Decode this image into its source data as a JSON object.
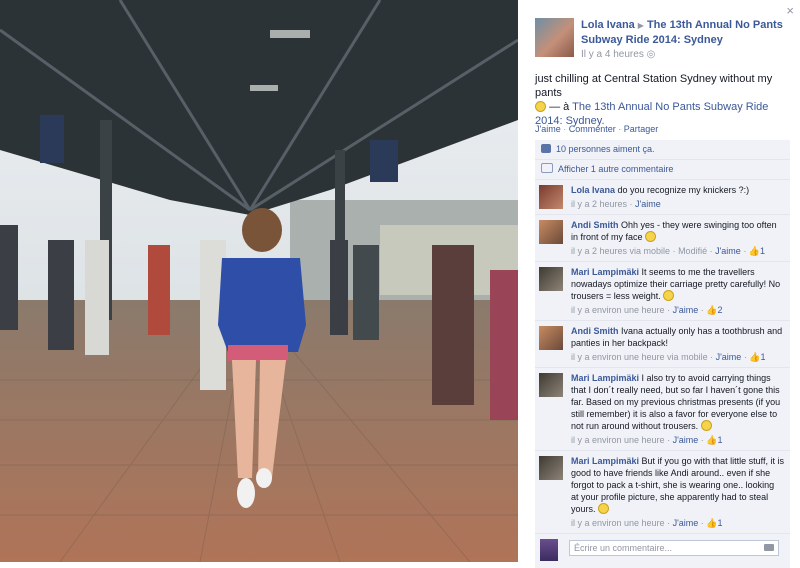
{
  "photo": {
    "alt": "Woman without pants walking on Sydney Central Station platform"
  },
  "header": {
    "author": "Lola Ivana",
    "event_link": "The 13th Annual No Pants Subway Ride 2014: Sydney",
    "time": "Il y a 4 heures"
  },
  "status": {
    "text": "just chilling at Central Station Sydney without my pants",
    "tag_prefix": "— à",
    "tag_link": "The 13th Annual No Pants Subway Ride 2014: Sydney."
  },
  "actions": {
    "like": "J'aime",
    "comment": "Commenter",
    "share": "Partager"
  },
  "likes": "10 personnes aiment ça.",
  "show_more": "Afficher 1 autre commentaire",
  "comments": [
    {
      "author": "Lola Ivana",
      "text": "do you recognize my knickers ?:)",
      "time": "il y a 2 heures",
      "like": "J'aime",
      "count": ""
    },
    {
      "author": "Andi Smith",
      "text": "Ohh yes - they were swinging too often in front of my face",
      "time": "il y a 2 heures via mobile",
      "extra": "Modifié",
      "like": "J'aime",
      "count": "1"
    },
    {
      "author": "Mari Lampimäki",
      "text": "It seems to me the travellers nowadays optimize their carriage pretty carefully! No trousers = less weight.",
      "time": "il y a environ une heure",
      "like": "J'aime",
      "count": "2"
    },
    {
      "author": "Andi Smith",
      "text": "Ivana actually only has a toothbrush and panties in her backpack!",
      "time": "il y a environ une heure via mobile",
      "like": "J'aime",
      "count": "1"
    },
    {
      "author": "Mari Lampimäki",
      "text": "I also try to avoid carrying things that I don´t really need, but so far I haven´t gone this far. Based on my previous christmas presents (if you still remember) it is also a favor for everyone else to not run around without trousers.",
      "time": "il y a environ une heure",
      "like": "J'aime",
      "count": "1"
    },
    {
      "author": "Mari Lampimäki",
      "text": "But if you go with that little stuff, it is good to have friends like Andi around.. even if she forgot to pack a t-shirt, she is wearing one.. looking at your profile picture, she apparently had to steal yours.",
      "time": "il y a environ une heure",
      "like": "J'aime",
      "count": "1"
    }
  ],
  "composer": {
    "placeholder": "Écrire un commentaire..."
  },
  "close": "×"
}
